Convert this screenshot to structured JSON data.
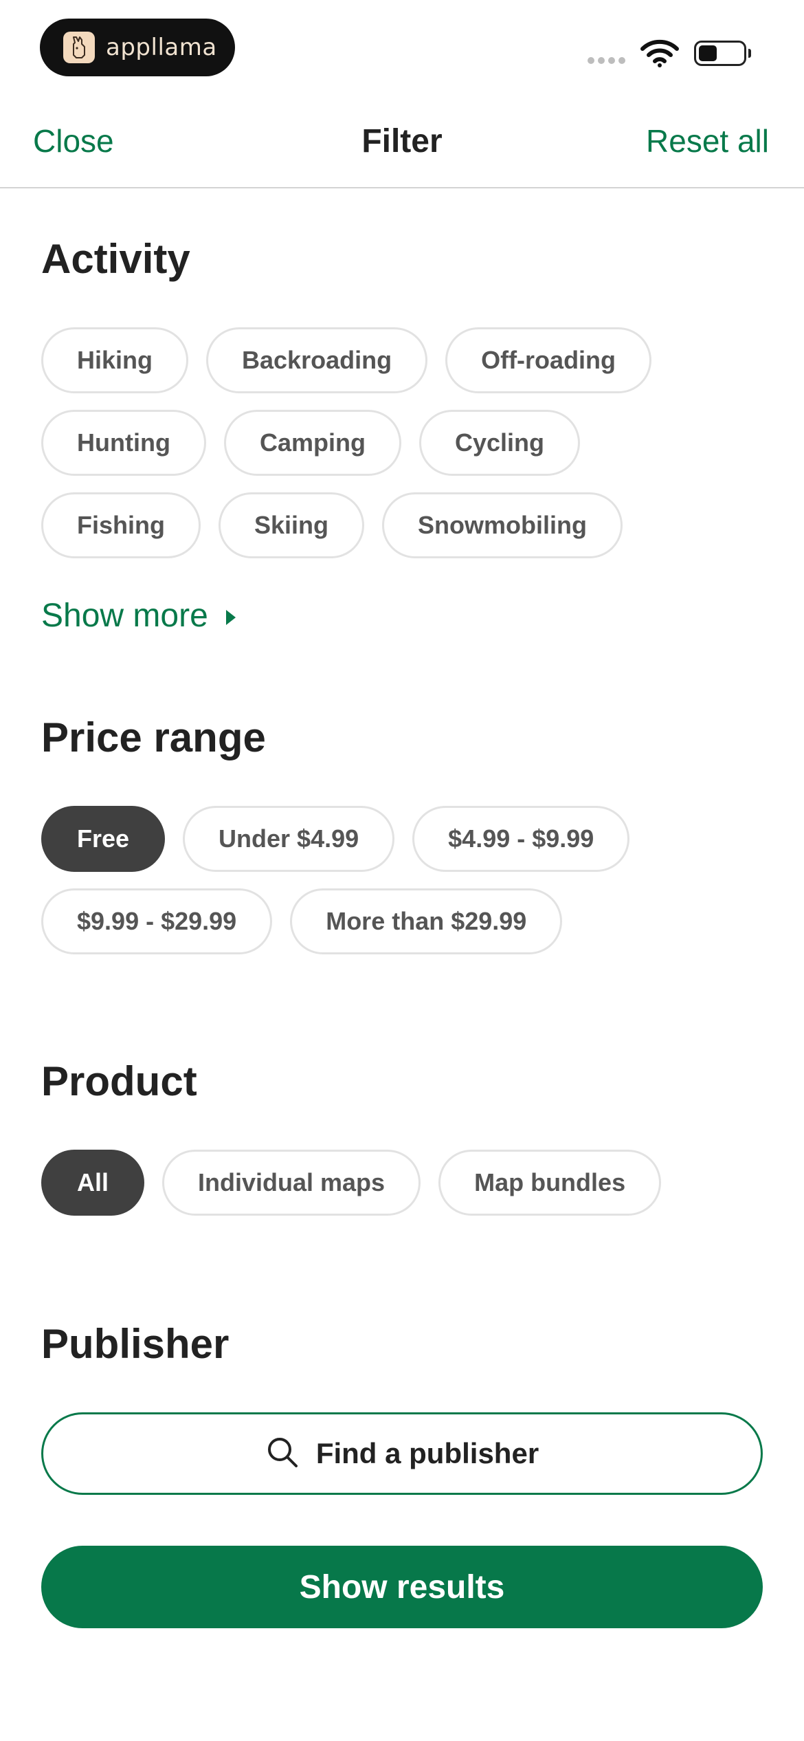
{
  "status_bar": {
    "brand_name": "appllama",
    "brand_icon": "llama-logo-icon",
    "wifi_icon": "wifi-icon",
    "battery_icon": "battery-icon",
    "signal_icon": "cellular-signal-icon"
  },
  "nav": {
    "close_label": "Close",
    "title": "Filter",
    "reset_label": "Reset all"
  },
  "activity": {
    "title": "Activity",
    "chips": [
      "Hiking",
      "Backroading",
      "Off-roading",
      "Hunting",
      "Camping",
      "Cycling",
      "Fishing",
      "Skiing",
      "Snowmobiling"
    ],
    "show_more_label": "Show more"
  },
  "price_range": {
    "title": "Price range",
    "chips": [
      "Free",
      "Under $4.99",
      "$4.99 - $9.99",
      "$9.99 - $29.99",
      "More than $29.99"
    ],
    "selected": "Free"
  },
  "product": {
    "title": "Product",
    "chips": [
      "All",
      "Individual maps",
      "Map bundles"
    ],
    "selected": "All"
  },
  "publisher": {
    "title": "Publisher",
    "search_label": "Find a publisher"
  },
  "footer": {
    "show_results_label": "Show results"
  },
  "colors": {
    "accent": "#08794A",
    "selected_chip": "#404040",
    "chip_border": "#E2E2E2",
    "chip_text": "#555555"
  }
}
